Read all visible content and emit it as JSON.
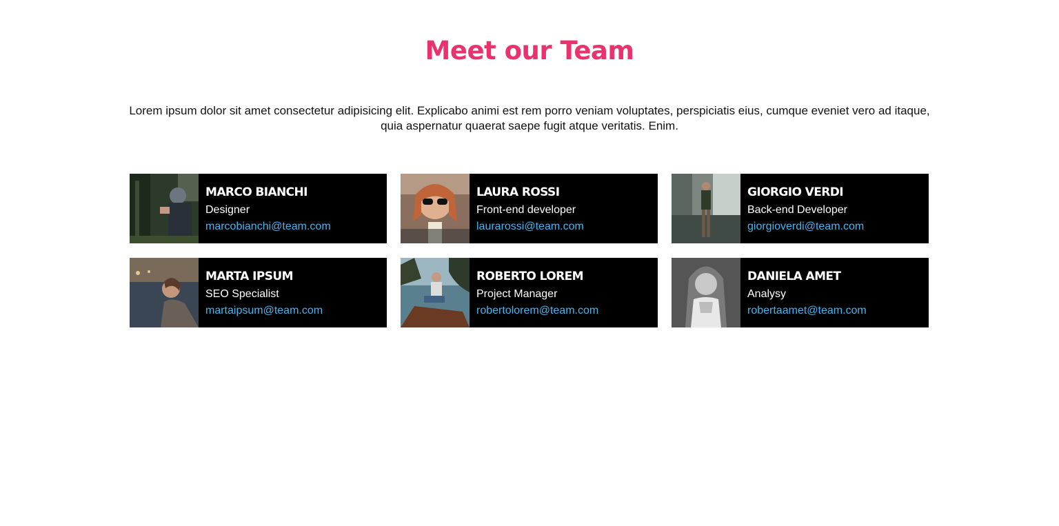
{
  "title": "Meet our Team",
  "intro": "Lorem ipsum dolor sit amet consectetur adipisicing elit. Explicabo animi est rem porro veniam voluptates, perspiciatis eius, cumque eveniet vero ad itaque, quia aspernatur quaerat saepe fugit atque veritatis. Enim.",
  "colors": {
    "accent": "#e8336f",
    "card_bg": "#000000",
    "link": "#48b4f0"
  },
  "members": [
    {
      "name": "MARCO BIANCHI",
      "role": "Designer",
      "email": "marcobianchi@team.com"
    },
    {
      "name": "LAURA ROSSI",
      "role": "Front-end developer",
      "email": "laurarossi@team.com"
    },
    {
      "name": "GIORGIO VERDI",
      "role": "Back-end Developer",
      "email": "giorgioverdi@team.com"
    },
    {
      "name": "MARTA IPSUM",
      "role": "SEO Specialist",
      "email": "martaipsum@team.com"
    },
    {
      "name": "ROBERTO LOREM",
      "role": "Project Manager",
      "email": "robertolorem@team.com"
    },
    {
      "name": "DANIELA AMET",
      "role": "Analysy",
      "email": "robertaamet@team.com"
    }
  ]
}
